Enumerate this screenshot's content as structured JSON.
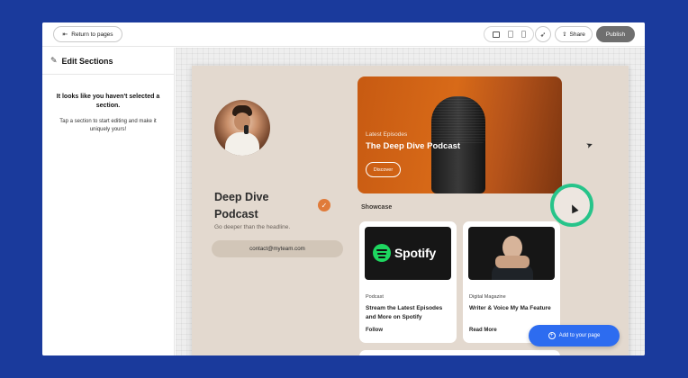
{
  "topbar": {
    "return_label": "Return to pages",
    "share_label": "Share",
    "publish_label": "Publish",
    "return_icon": "return-arrow-icon",
    "share_icon": "share-icon",
    "rocket_icon": "rocket-icon"
  },
  "left_panel": {
    "title": "Edit Sections",
    "empty_title": "It looks like you haven't selected a section.",
    "empty_subtitle": "Tap a section to start editing and make it uniquely yours!"
  },
  "profile": {
    "name": "Deep Dive Podcast",
    "tagline": "Go deeper than the headline.",
    "email": "contact@myteam.com"
  },
  "hero": {
    "eyebrow": "Latest Episodes",
    "title": "The Deep Dive Podcast",
    "button": "Discover"
  },
  "showcase": {
    "label": "Showcase",
    "cards": [
      {
        "category": "Podcast",
        "title": "Stream the Latest Episodes and More on Spotify",
        "action": "Follow",
        "logo_text": "Spotify"
      },
      {
        "category": "Digital Magazine",
        "title": "Writer & Voice My Ma Feature",
        "action": "Read More"
      }
    ]
  },
  "add_button": {
    "label": "Add to your page"
  },
  "colors": {
    "background": "#1a3a9c",
    "page_bg": "#e3d9cf",
    "accent_orange": "#d86a18",
    "add_blue": "#2d6cf0",
    "cursor_ring": "#27c48a",
    "spotify_green": "#1ed760"
  }
}
